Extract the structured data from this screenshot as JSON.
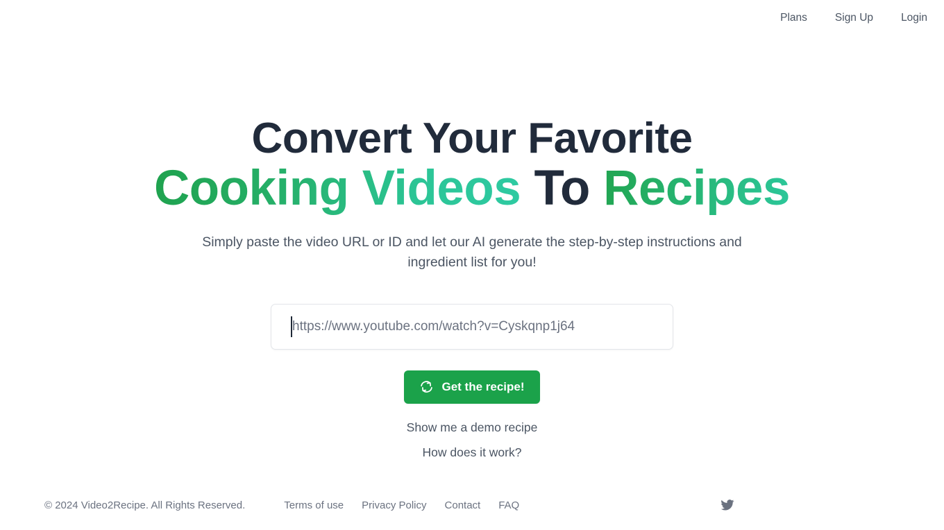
{
  "header": {
    "nav": [
      {
        "label": "Plans",
        "name": "nav-link-plans"
      },
      {
        "label": "Sign Up",
        "name": "nav-link-signup"
      },
      {
        "label": "Login",
        "name": "nav-link-login"
      }
    ]
  },
  "hero": {
    "headline_line1": "Convert Your Favorite",
    "headline_line2_part1": "Cooking Videos",
    "headline_line2_part2": "To",
    "headline_line2_part3": "Recipes",
    "subtitle": "Simply paste the video URL or ID and let our AI generate the step-by-step instructions and ingredient list for you!",
    "input": {
      "placeholder": "https://www.youtube.com/watch?v=Cyskqnp1j64",
      "value": ""
    },
    "cta_label": "Get the recipe!",
    "cta_icon": "sync-icon",
    "links": [
      {
        "label": "Show me a demo recipe",
        "name": "demo-recipe-link"
      },
      {
        "label": "How does it work?",
        "name": "how-it-works-link"
      }
    ]
  },
  "footer": {
    "copyright": "© 2024 Video2Recipe. All Rights Reserved.",
    "links": [
      {
        "label": "Terms of use",
        "name": "footer-link-terms"
      },
      {
        "label": "Privacy Policy",
        "name": "footer-link-privacy"
      },
      {
        "label": "Contact",
        "name": "footer-link-contact"
      },
      {
        "label": "FAQ",
        "name": "footer-link-faq"
      }
    ],
    "social_icon": "twitter-icon"
  },
  "colors": {
    "background": "#ffffff",
    "heading_dark": "#212b3b",
    "accent_green": "#1ba24a",
    "accent_teal": "#2ecaa2",
    "body_text": "#4b5563",
    "muted_text": "#6b7280",
    "border": "#e3e5e9"
  }
}
